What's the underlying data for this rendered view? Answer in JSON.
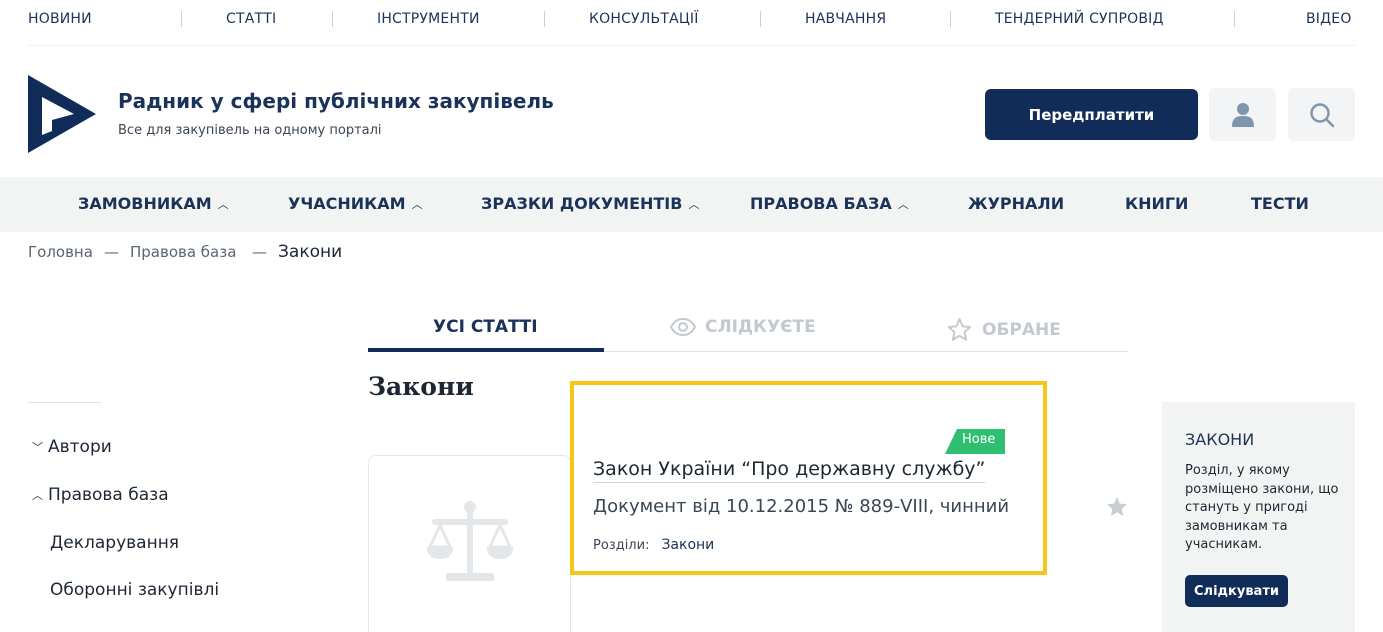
{
  "top_nav": [
    "НОВИНИ",
    "СТАТТІ",
    "ІНСТРУМЕНТИ",
    "КОНСУЛЬТАЦІЇ",
    "НАВЧАННЯ",
    "ТЕНДЕРНИЙ СУПРОВІД",
    "ВІДЕО"
  ],
  "header": {
    "title": "Радник у сфері публічних закупівель",
    "subtitle": "Все для закупівель на одному порталі",
    "subscribe_label": "Передплатити",
    "user_icon": "user-icon",
    "search_icon": "search-icon"
  },
  "main_nav": [
    "ЗАМОВНИКАМ",
    "УЧАСНИКАМ",
    "ЗРАЗКИ ДОКУМЕНТІВ",
    "ПРАВОВА БАЗА",
    "ЖУРНАЛИ",
    "КНИГИ",
    "ТЕСТИ"
  ],
  "breadcrumb": {
    "items": [
      "Головна",
      "Правова база"
    ],
    "separator": "—",
    "current": "Закони"
  },
  "tabs": [
    "УСІ СТАТТІ",
    "СЛІДКУЄТЕ",
    "ОБРАНЕ"
  ],
  "section_title": "Закони",
  "sidebar": [
    "Автори",
    "Правова база",
    "Декларування",
    "Оборонні закупівлі"
  ],
  "card": {
    "badge": "Нове",
    "title": "Закон України “Про державну службу”",
    "description": "Документ від 10.12.2015 № 889-VIII, чинний",
    "sections_label": "Розділи:",
    "sections_link": "Закони"
  },
  "info_box": {
    "title": "ЗАКОНИ",
    "text": "Розділ, у якому розміщено закони, що стануть у пригоді замовникам та учасникам.",
    "follow_label": "Слідкувати"
  },
  "colors": {
    "brand": "#112c59",
    "badge": "#2fbf71",
    "highlight": "#f5c518"
  }
}
